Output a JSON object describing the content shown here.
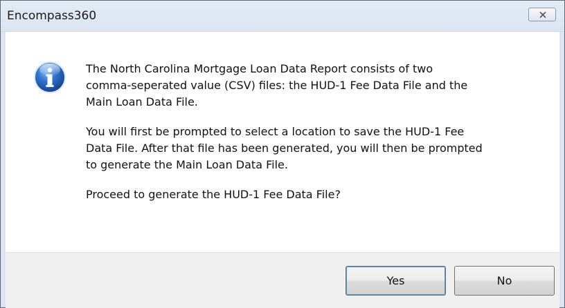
{
  "window": {
    "title": "Encompass360",
    "close_icon": "close-icon"
  },
  "message": {
    "icon": "info-icon",
    "paragraphs": [
      "The North Carolina Mortgage Loan Data Report consists of two\ncomma-seperated value (CSV) files: the HUD-1 Fee Data File and the\nMain Loan Data File.",
      "You will first be prompted to select a location to save the HUD-1 Fee\nData File. After that file has been generated, you will then be prompted\nto generate the Main Loan Data File.",
      "Proceed to generate the HUD-1 Fee Data File?"
    ]
  },
  "buttons": {
    "yes_label": "Yes",
    "no_label": "No"
  },
  "colors": {
    "titlebar": "#dbe4f0",
    "content_bg": "#ffffff",
    "footer_bg": "#f0f0f0",
    "focus_ring": "#3c9bd8",
    "info_icon_blue": "#1f5fb4"
  }
}
